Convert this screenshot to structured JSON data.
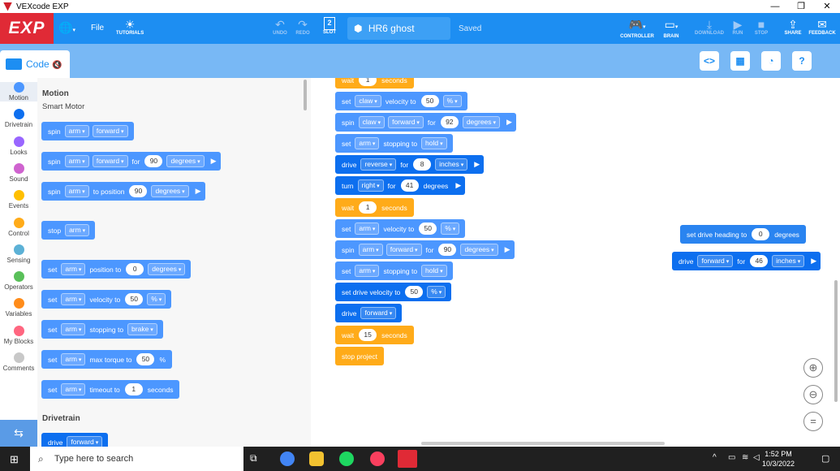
{
  "window": {
    "title": "VEXcode EXP",
    "min": "—",
    "max": "❐",
    "close": "✕"
  },
  "toolbar": {
    "logo": "EXP",
    "file": "File",
    "tutorials": "TUTORIALS",
    "undo": "UNDO",
    "redo": "REDO",
    "slot": "SLOT",
    "slot_num": "2",
    "project_name": "HR6 ghost",
    "saved": "Saved",
    "controller": "CONTROLLER",
    "brain": "BRAIN",
    "download": "DOWNLOAD",
    "run": "RUN",
    "stop": "STOP",
    "share": "SHARE",
    "feedback": "FEEDBACK"
  },
  "code_tab": {
    "label": "Code"
  },
  "categories": [
    {
      "label": "Motion",
      "color": "#4c97ff"
    },
    {
      "label": "Drivetrain",
      "color": "#0d6fef"
    },
    {
      "label": "Looks",
      "color": "#9966ff"
    },
    {
      "label": "Sound",
      "color": "#cf63cf"
    },
    {
      "label": "Events",
      "color": "#ffbf00"
    },
    {
      "label": "Control",
      "color": "#ffab19"
    },
    {
      "label": "Sensing",
      "color": "#5cb1d6"
    },
    {
      "label": "Operators",
      "color": "#59c059"
    },
    {
      "label": "Variables",
      "color": "#ff8c1a"
    },
    {
      "label": "My Blocks",
      "color": "#ff6680"
    },
    {
      "label": "Comments",
      "color": "#c8c8c8"
    }
  ],
  "palette": {
    "section_title": "Motion",
    "subtitle": "Smart Motor",
    "section2": "Drivetrain",
    "b1": {
      "t1": "spin",
      "d1": "arm",
      "d2": "forward"
    },
    "b2": {
      "t1": "spin",
      "d1": "arm",
      "d2": "forward",
      "t2": "for",
      "n1": "90",
      "d3": "degrees"
    },
    "b3": {
      "t1": "spin",
      "d1": "arm",
      "t2": "to position",
      "n1": "90",
      "d2": "degrees"
    },
    "b4": {
      "t1": "stop",
      "d1": "arm"
    },
    "b5": {
      "t1": "set",
      "d1": "arm",
      "t2": "position to",
      "n1": "0",
      "d2": "degrees"
    },
    "b6": {
      "t1": "set",
      "d1": "arm",
      "t2": "velocity to",
      "n1": "50",
      "d2": "%"
    },
    "b7": {
      "t1": "set",
      "d1": "arm",
      "t2": "stopping to",
      "d2": "brake"
    },
    "b8": {
      "t1": "set",
      "d1": "arm",
      "t2": "max torque to",
      "n1": "50",
      "t3": "%"
    },
    "b9": {
      "t1": "set",
      "d1": "arm",
      "t2": "timeout to",
      "n1": "1",
      "t3": "seconds"
    },
    "b10": {
      "t1": "drive",
      "d1": "forward"
    }
  },
  "workspace": {
    "s0": {
      "t1": "wait",
      "n1": "1",
      "t2": "seconds"
    },
    "s1": {
      "t1": "set",
      "d1": "claw",
      "t2": "velocity to",
      "n1": "50",
      "d2": "%"
    },
    "s2": {
      "t1": "spin",
      "d1": "claw",
      "d2": "forward",
      "t2": "for",
      "n1": "92",
      "d3": "degrees"
    },
    "s3": {
      "t1": "set",
      "d1": "arm",
      "t2": "stopping to",
      "d2": "hold"
    },
    "s4": {
      "t1": "drive",
      "d1": "reverse",
      "t2": "for",
      "n1": "8",
      "d2": "inches"
    },
    "s5": {
      "t1": "turn",
      "d1": "right",
      "t2": "for",
      "n1": "41",
      "t3": "degrees"
    },
    "s6": {
      "t1": "wait",
      "n1": "1",
      "t2": "seconds"
    },
    "s7": {
      "t1": "set",
      "d1": "arm",
      "t2": "velocity to",
      "n1": "50",
      "d2": "%"
    },
    "s8": {
      "t1": "spin",
      "d1": "arm",
      "d2": "forward",
      "t2": "for",
      "n1": "90",
      "d3": "degrees"
    },
    "s9": {
      "t1": "set",
      "d1": "arm",
      "t2": "stopping to",
      "d2": "hold"
    },
    "s10": {
      "t1": "set drive velocity to",
      "n1": "50",
      "d1": "%"
    },
    "s11": {
      "t1": "drive",
      "d1": "forward"
    },
    "s12": {
      "t1": "wait",
      "n1": "15",
      "t2": "seconds"
    },
    "s13": {
      "t1": "stop project"
    },
    "f1": {
      "t1": "set drive heading to",
      "n1": "0",
      "t2": "degrees"
    },
    "f2": {
      "t1": "drive",
      "d1": "forward",
      "t2": "for",
      "n1": "46",
      "d2": "inches"
    }
  },
  "taskbar": {
    "search_placeholder": "Type here to search",
    "time": "1:52 PM",
    "date": "10/3/2022"
  }
}
